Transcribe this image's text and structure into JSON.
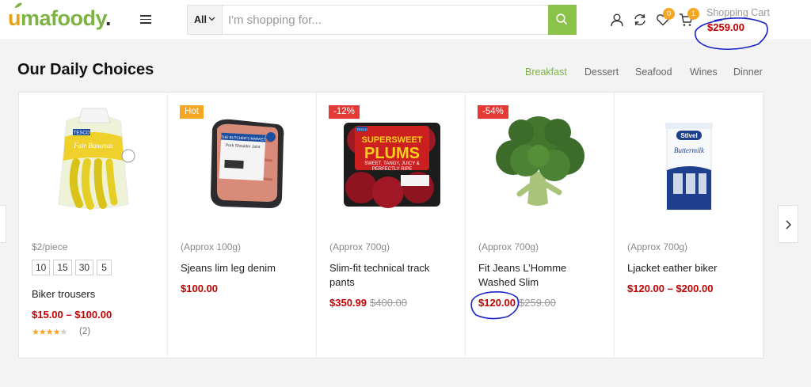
{
  "header": {
    "logo": {
      "o": "u",
      "rest": "mafoody",
      "dot": "."
    },
    "search": {
      "category": "All",
      "placeholder": "I'm shopping for..."
    },
    "icons": [
      "user-icon",
      "compare-icon",
      "wishlist-icon",
      "cart-icon",
      "search-icon",
      "hamburger-menu-icon"
    ],
    "wishlist_count": "0",
    "cart_count": "1",
    "cart_label": "Shopping Cart",
    "cart_total": "$259.00"
  },
  "section": {
    "title": "Our Daily Choices",
    "tabs": [
      "Breakfast",
      "Dessert",
      "Seafood",
      "Wines",
      "Dinner"
    ],
    "active_tab": "Breakfast"
  },
  "products": [
    {
      "unit": "$2/piece",
      "sizes": [
        "10",
        "15",
        "30",
        "5"
      ],
      "name": "Biker trousers",
      "price": "$15.00 – $100.00",
      "rating": 4,
      "reviews": "(2)",
      "image": "bananas"
    },
    {
      "tag": "Hot",
      "unit": "(Approx 100g)",
      "name": "Sjeans lim leg denim",
      "price": "$100.00",
      "image": "pork-shoulder"
    },
    {
      "tag": "-12%",
      "unit": "(Approx 700g)",
      "name": "Slim-fit technical track pants",
      "price": "$350.99",
      "old_price": "$400.00",
      "image": "plums"
    },
    {
      "tag": "-54%",
      "unit": "(Approx 700g)",
      "name": "Fit Jeans L’Homme Washed Slim",
      "price": "$120.00",
      "old_price": "$259.00",
      "image": "broccoli"
    },
    {
      "unit": "(Approx 700g)",
      "name": "Ljacket eather biker",
      "price": "$120.00 – $200.00",
      "image": "buttermilk"
    }
  ],
  "product_images": {
    "bananas": {
      "brand": "TESCO",
      "label": "Fair Bananas"
    },
    "pork": {
      "brand": "THE BUTCHER'S MARKET",
      "label": "Pork Shoulder Joint"
    },
    "plums": {
      "brand": "TESCO",
      "line1": "SUPERSWEET",
      "line2": "PLUMS",
      "tagline1": "SWEET, TANGY, JUICY &",
      "tagline2": "PERFECTLY RIPE"
    },
    "buttermilk": {
      "brand": "Stlvel",
      "label": "Buttermilk"
    }
  },
  "colors": {
    "accent": "#8bc34a",
    "price": "#c40000",
    "badge": "#f5a623",
    "sale_tag": "#e53935",
    "annotation_ink": "#1a23c8"
  }
}
